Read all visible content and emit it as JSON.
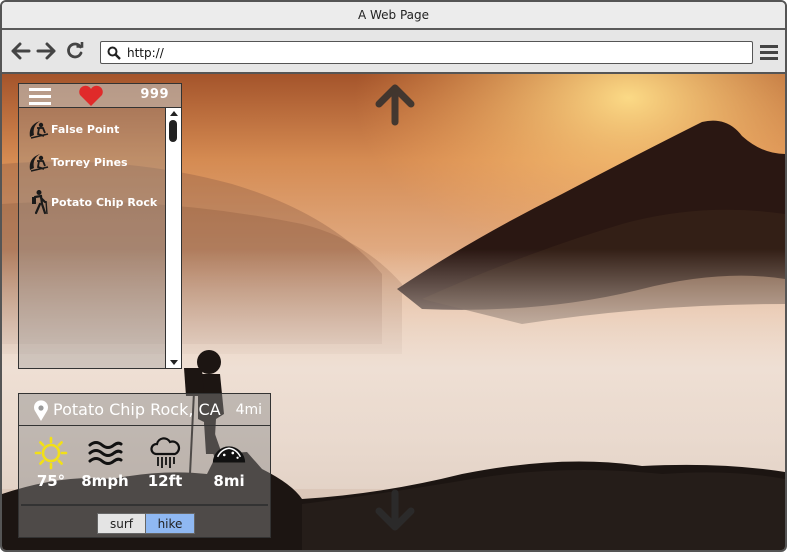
{
  "window": {
    "title": "A Web Page"
  },
  "browser": {
    "url": "http://"
  },
  "sidebar": {
    "count": "999",
    "items": [
      {
        "label": "False Point",
        "icon": "surfer-icon"
      },
      {
        "label": "Torrey Pines",
        "icon": "surfer-icon"
      },
      {
        "label": "Potato Chip Rock",
        "icon": "hiker-icon"
      }
    ]
  },
  "card": {
    "place": "Potato Chip Rock, CA",
    "distance": "4mi",
    "stats": [
      {
        "icon": "sun-icon",
        "value": "75°"
      },
      {
        "icon": "wind-icon",
        "value": "8mph"
      },
      {
        "icon": "rain-cloud-icon",
        "value": "12ft"
      },
      {
        "icon": "taco-icon",
        "value": "8mi"
      }
    ],
    "tabs": {
      "surf": "surf",
      "hike": "hike"
    }
  },
  "colors": {
    "heart": "#e02a2a",
    "active_tab": "#8fb8f2",
    "sun": "#f2e017"
  }
}
